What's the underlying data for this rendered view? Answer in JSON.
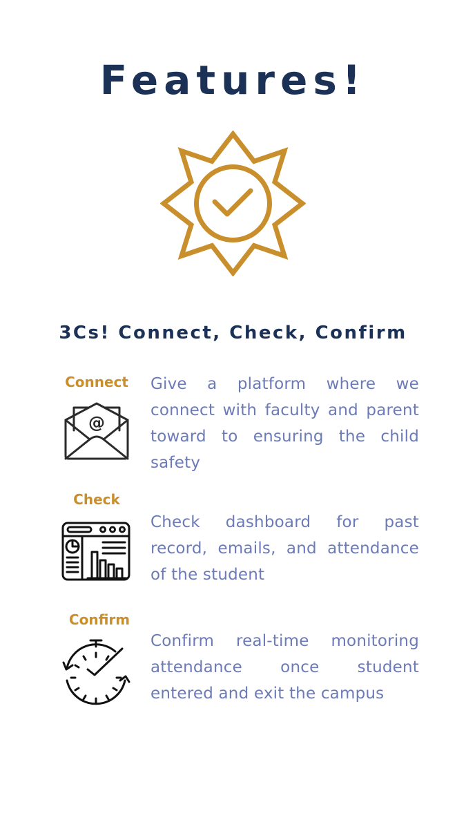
{
  "title": "Features!",
  "badge_icon": "check-badge-icon",
  "subtitle": "3Cs! Connect, Check, Confirm",
  "colors": {
    "navy": "#1b3156",
    "gold": "#c98f2c",
    "text": "#6c7bb8"
  },
  "features": [
    {
      "label": "Connect",
      "icon": "email-envelope-icon",
      "description": "Give a platform where we connect with faculty and parent toward to ensuring the child safety"
    },
    {
      "label": "Check",
      "icon": "dashboard-icon",
      "description": "Check dashboard for past record, emails, and attendance of the student"
    },
    {
      "label": "Confirm",
      "icon": "stopwatch-check-icon",
      "description": "Confirm real-time monitoring attendance once student entered and exit the campus"
    }
  ]
}
